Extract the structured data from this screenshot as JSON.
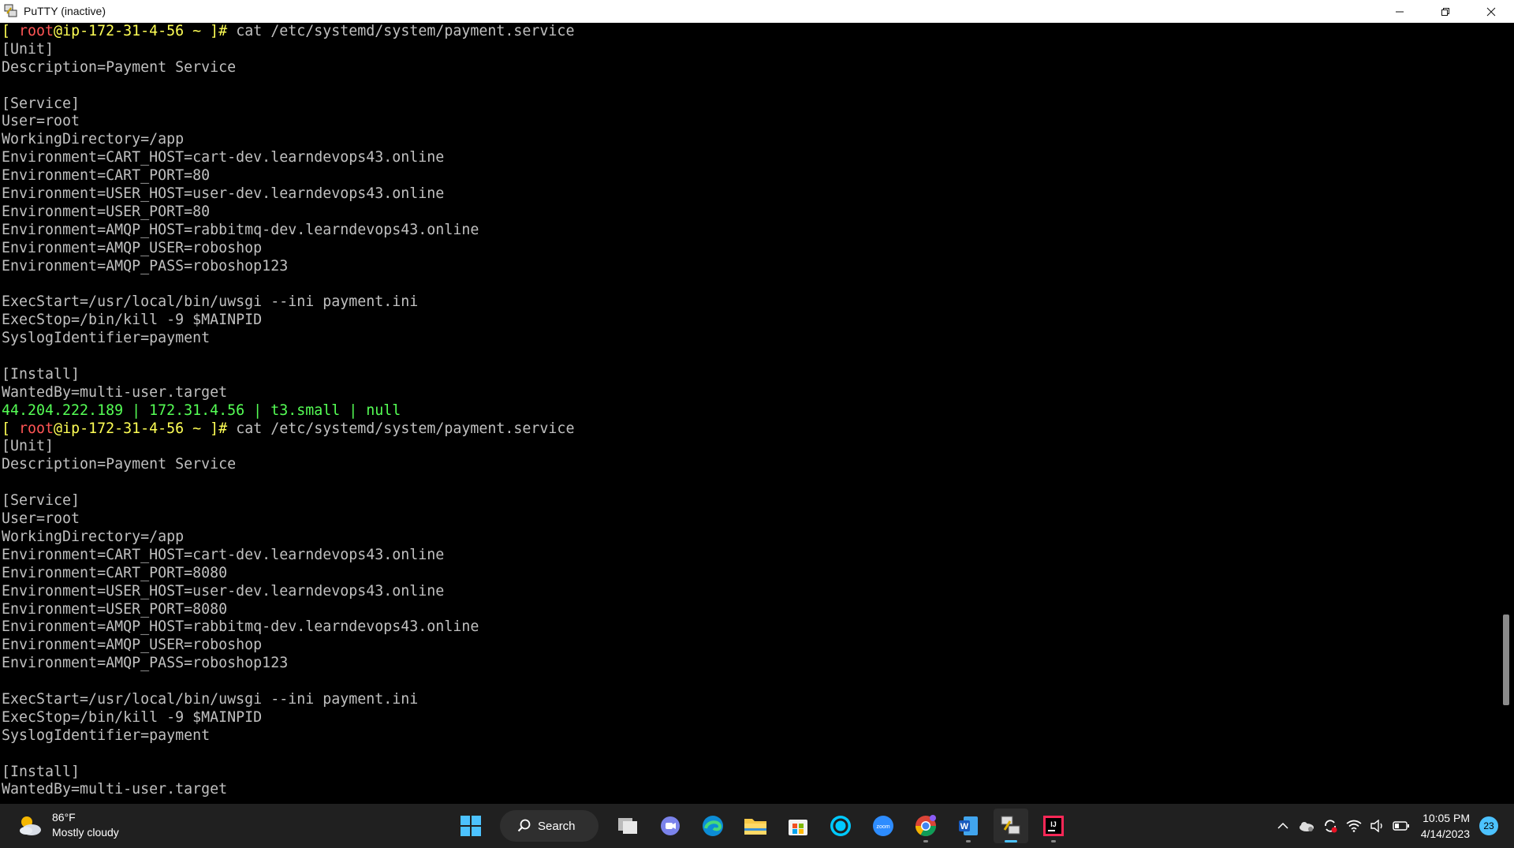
{
  "window": {
    "title": "PuTTY (inactive)"
  },
  "prompt": {
    "open": "[ ",
    "user": "root",
    "at": "@",
    "host": "ip-172-31-4-56",
    "rest": " ~ ]# "
  },
  "commands": {
    "first": "cat /etc/systemd/system/payment.service",
    "second": "cat /etc/systemd/system/payment.service"
  },
  "output1": [
    "[Unit]",
    "Description=Payment Service",
    "",
    "[Service]",
    "User=root",
    "WorkingDirectory=/app",
    "Environment=CART_HOST=cart-dev.learndevops43.online",
    "Environment=CART_PORT=80",
    "Environment=USER_HOST=user-dev.learndevops43.online",
    "Environment=USER_PORT=80",
    "Environment=AMQP_HOST=rabbitmq-dev.learndevops43.online",
    "Environment=AMQP_USER=roboshop",
    "Environment=AMQP_PASS=roboshop123",
    "",
    "ExecStart=/usr/local/bin/uwsgi --ini payment.ini",
    "ExecStop=/bin/kill -9 $MAINPID",
    "SyslogIdentifier=payment",
    "",
    "[Install]",
    "WantedBy=multi-user.target"
  ],
  "status_line": "44.204.222.189 | 172.31.4.56 | t3.small | null",
  "output2": [
    "[Unit]",
    "Description=Payment Service",
    "",
    "[Service]",
    "User=root",
    "WorkingDirectory=/app",
    "Environment=CART_HOST=cart-dev.learndevops43.online",
    "Environment=CART_PORT=8080",
    "Environment=USER_HOST=user-dev.learndevops43.online",
    "Environment=USER_PORT=8080",
    "Environment=AMQP_HOST=rabbitmq-dev.learndevops43.online",
    "Environment=AMQP_USER=roboshop",
    "Environment=AMQP_PASS=roboshop123",
    "",
    "ExecStart=/usr/local/bin/uwsgi --ini payment.ini",
    "ExecStop=/bin/kill -9 $MAINPID",
    "SyslogIdentifier=payment",
    "",
    "[Install]",
    "WantedBy=multi-user.target"
  ],
  "taskbar": {
    "weather_temp": "86°F",
    "weather_desc": "Mostly cloudy",
    "search_label": "Search",
    "time": "10:05 PM",
    "date": "4/14/2023",
    "notification_count": "23"
  },
  "colors": {
    "root": "#ff5555",
    "host": "#ffff55",
    "status": "#55ff55",
    "text": "#c0c0c0",
    "accent": "#4cc2ff"
  }
}
